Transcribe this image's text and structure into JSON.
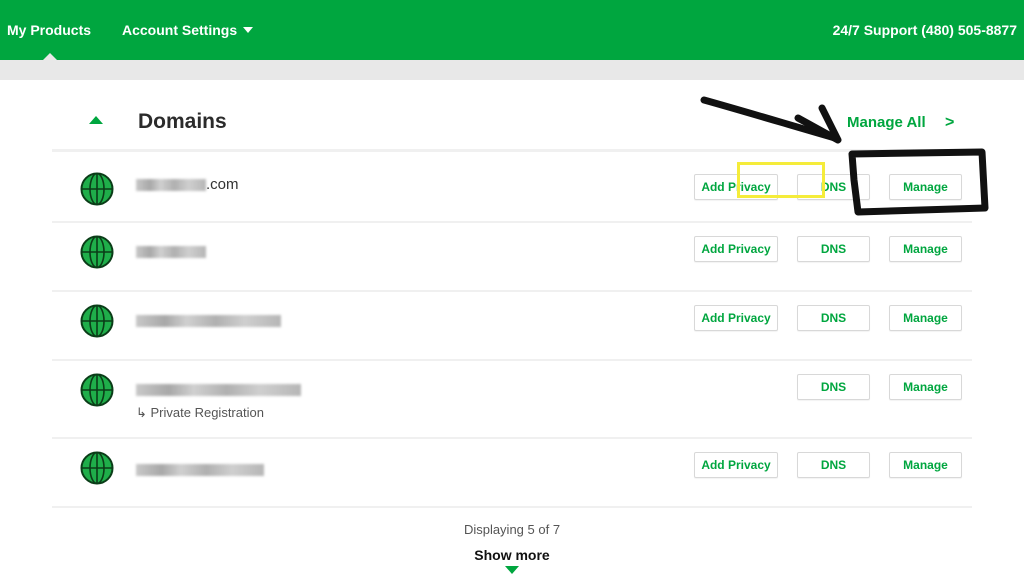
{
  "topbar": {
    "nav": [
      {
        "label": "My Products",
        "active": true
      },
      {
        "label": "Account Settings",
        "has_dropdown": true
      }
    ],
    "support": "24/7 Support (480) 505-8877",
    "color": "#00a63f"
  },
  "panel": {
    "title": "Domains",
    "manage_all": "Manage All",
    "manage_all_chevron": ">",
    "rows": [
      {
        "domain_suffix": ".com",
        "domain_redacted": true,
        "buttons": [
          "Add Privacy",
          "DNS",
          "Manage"
        ]
      },
      {
        "domain_suffix": "",
        "domain_redacted": true,
        "buttons": [
          "Add Privacy",
          "DNS",
          "Manage"
        ]
      },
      {
        "domain_suffix": "",
        "domain_redacted": true,
        "buttons": [
          "Add Privacy",
          "DNS",
          "Manage"
        ]
      },
      {
        "domain_suffix": "",
        "domain_redacted": true,
        "note": "↳ Private Registration",
        "buttons": [
          "DNS",
          "Manage"
        ]
      },
      {
        "domain_suffix": "",
        "domain_redacted": true,
        "buttons": [
          "Add Privacy",
          "DNS",
          "Manage"
        ]
      }
    ],
    "footer": {
      "count_text": "Displaying 5 of 7",
      "show_more": "Show more"
    }
  },
  "annotations": {
    "arrow": "black hand-drawn arrow pointing at DNS button",
    "highlight_dns": "yellow box around DNS",
    "highlight_manage": "black box around Manage"
  }
}
